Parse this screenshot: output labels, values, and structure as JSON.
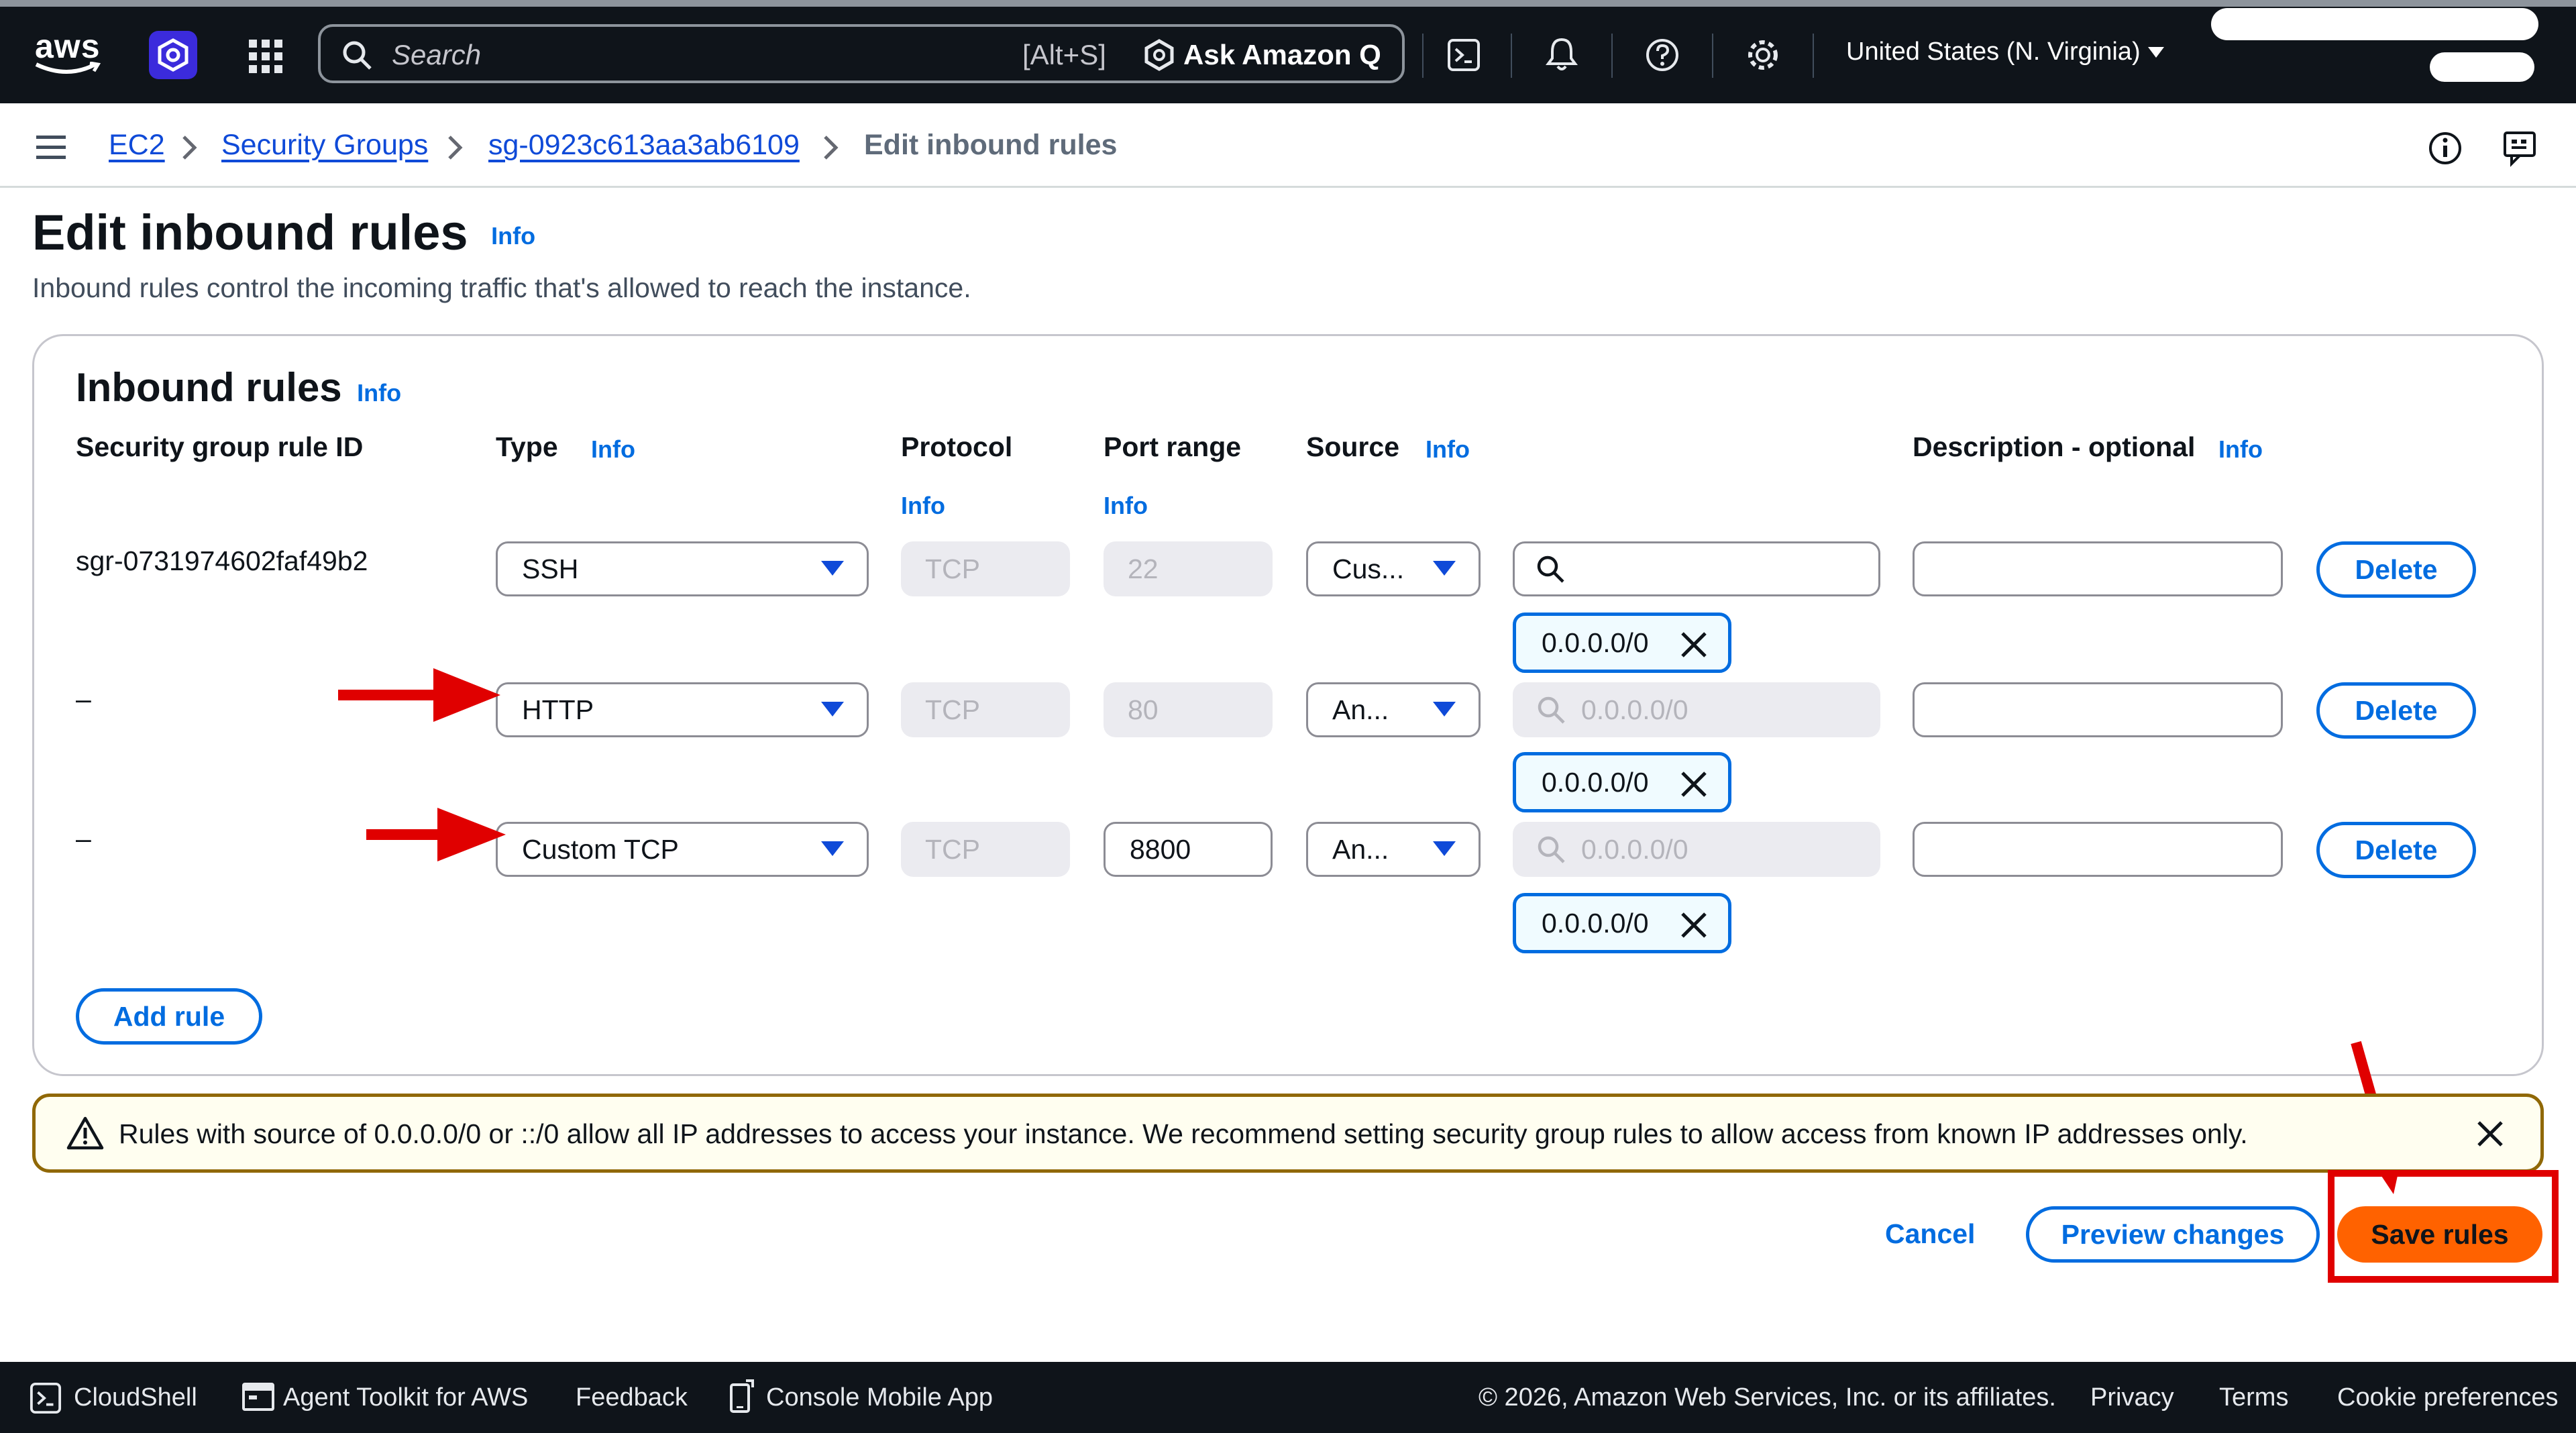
{
  "topnav": {
    "logo": "aws",
    "search_placeholder": "Search",
    "search_shortcut": "[Alt+S]",
    "ask_q": "Ask Amazon Q",
    "region": "United States (N. Virginia)"
  },
  "breadcrumb": {
    "items": [
      "EC2",
      "Security Groups",
      "sg-0923c613aa3ab6109"
    ],
    "current": "Edit inbound rules"
  },
  "header": {
    "title": "Edit inbound rules",
    "info": "Info",
    "description": "Inbound rules control the incoming traffic that's allowed to reach the instance."
  },
  "panel": {
    "title": "Inbound rules",
    "info": "Info",
    "columns": {
      "rule_id": "Security group rule ID",
      "type": "Type",
      "protocol": "Protocol",
      "port_range": "Port range",
      "source": "Source",
      "description": "Description - optional"
    },
    "rows": [
      {
        "rule_id": "sgr-0731974602faf49b2",
        "type": "SSH",
        "protocol": "TCP",
        "port": "22",
        "source_type": "Cus...",
        "source_value": "",
        "token": "0.0.0.0/0",
        "delete": "Delete"
      },
      {
        "rule_id": "–",
        "type": "HTTP",
        "protocol": "TCP",
        "port": "80",
        "source_type": "An...",
        "source_value": "0.0.0.0/0",
        "token": "0.0.0.0/0",
        "delete": "Delete"
      },
      {
        "rule_id": "–",
        "type": "Custom TCP",
        "protocol": "TCP",
        "port": "8800",
        "source_type": "An...",
        "source_value": "0.0.0.0/0",
        "token": "0.0.0.0/0",
        "delete": "Delete"
      }
    ],
    "add_rule": "Add rule"
  },
  "alert": {
    "text": "Rules with source of 0.0.0.0/0 or ::/0 allow all IP addresses to access your instance. We recommend setting security group rules to allow access from known IP addresses only."
  },
  "actions": {
    "cancel": "Cancel",
    "preview": "Preview changes",
    "save": "Save rules"
  },
  "footer": {
    "cloudshell": "CloudShell",
    "agent_toolkit": "Agent Toolkit for AWS",
    "feedback": "Feedback",
    "mobile_app": "Console Mobile App",
    "copyright": "© 2026, Amazon Web Services, Inc. or its affiliates.",
    "privacy": "Privacy",
    "terms": "Terms",
    "cookies": "Cookie preferences"
  },
  "colors": {
    "accent": "#006ce0",
    "primary_button": "#ff6200",
    "annotation_red": "#e00000",
    "nav_bg": "#0f141a"
  },
  "icons": [
    "aws-logo",
    "app-launcher-icon",
    "grid-icon",
    "search-icon",
    "amazon-q-icon",
    "cloudshell-icon",
    "bell-icon",
    "help-icon",
    "gear-icon",
    "menu-icon",
    "info-circle-icon",
    "feedback-icon",
    "warning-icon",
    "close-icon",
    "mobile-icon",
    "red-arrow"
  ]
}
